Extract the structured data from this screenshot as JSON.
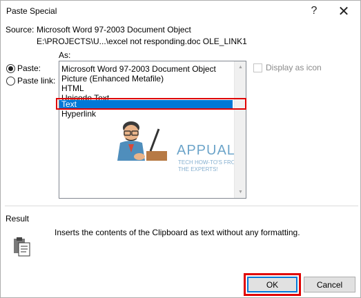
{
  "dialog": {
    "title": "Paste Special",
    "help_glyph": "?",
    "close_glyph": "✕"
  },
  "source": {
    "label": "Source:",
    "name": "Microsoft Word 97-2003 Document Object",
    "path": "E:\\PROJECTS\\U...\\excel not responding.doc OLE_LINK1"
  },
  "as_label": "As:",
  "options": {
    "paste_label": "Paste:",
    "paste_link_label": "Paste link:",
    "selected": "paste"
  },
  "list": {
    "items": [
      "Microsoft Word 97-2003 Document Object",
      "Picture (Enhanced Metafile)",
      "HTML",
      "Unicode Text",
      "Text",
      "Hyperlink"
    ],
    "selected_index": 4
  },
  "display_as_icon": {
    "label": "Display as icon",
    "checked": false
  },
  "watermark": {
    "brand": "APPUALS",
    "tagline_line1": "TECH HOW-TO'S FROM",
    "tagline_line2": "THE EXPERTS!"
  },
  "result": {
    "label": "Result",
    "text": "Inserts the contents of the Clipboard as text without any formatting.",
    "icon": "clipboard-icon"
  },
  "buttons": {
    "ok": "OK",
    "cancel": "Cancel"
  },
  "colors": {
    "selection": "#0078d7",
    "highlight": "#e00000"
  }
}
